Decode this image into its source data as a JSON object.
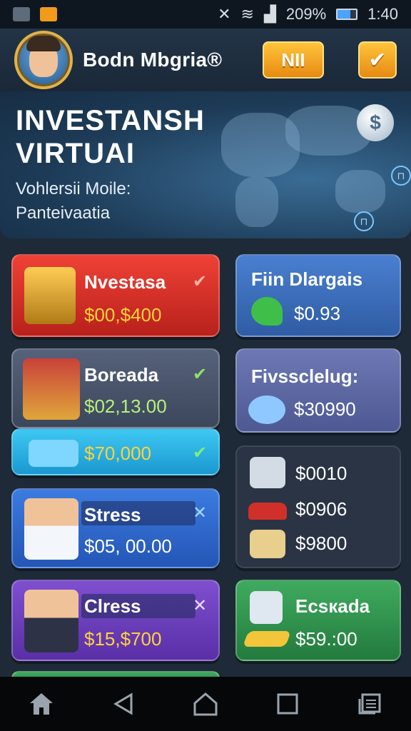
{
  "status": {
    "battery": "209%",
    "time": "1:40"
  },
  "header": {
    "brand": "Bodn Mbgria®",
    "nii_label": "NII",
    "check_label": "✔"
  },
  "hero": {
    "title_line1": "INVESTANSH",
    "title_line2": "VIRTUAI",
    "subtitle_line1": "Vohlersii Moile:",
    "subtitle_line2": "Panteivaatia",
    "coin_symbol": "$",
    "orb_glyph": "⊓"
  },
  "cards": {
    "nvestasa": {
      "title": "Nvestasa",
      "amount": "$00,$400",
      "mark": "✔"
    },
    "fiin": {
      "title": "Fiin Dlargais",
      "amount": "$0.93"
    },
    "boreada": {
      "title": "Boreada",
      "amount": "$02,13.00",
      "mark": "✔"
    },
    "fivss": {
      "title": "Fivssclelug:",
      "amount": "$30990"
    },
    "cyan": {
      "amount": "$70,000",
      "mark": "✔"
    },
    "list": {
      "items": [
        "$0010",
        "$0906",
        "$9800"
      ]
    },
    "stress": {
      "title": "Stress",
      "amount": "$05, 00.00",
      "mark": "✕"
    },
    "clress": {
      "title": "Clress",
      "amount": "$15,$700",
      "mark": "✕"
    },
    "ecskada": {
      "title": "Ecsкada",
      "amount": "$59.:00"
    }
  },
  "nav": {
    "items": [
      "home-icon",
      "back-icon",
      "home-outline-icon",
      "recents-icon",
      "menu-icon"
    ]
  }
}
